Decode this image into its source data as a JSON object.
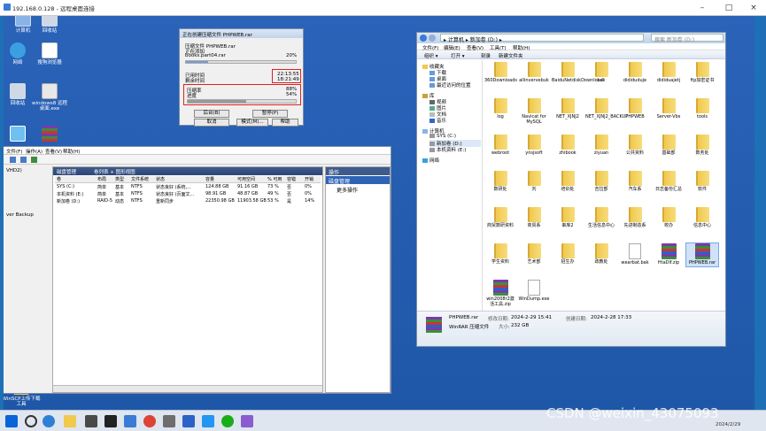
{
  "rdp": {
    "title": "192.168.0.128 - 远程桌面连接"
  },
  "desktop_icons": [
    {
      "label": "计算机",
      "icon": "computer-icon"
    },
    {
      "label": "回收站",
      "icon": "recycle-bin-icon"
    },
    {
      "label": "网络",
      "icon": "network-icon"
    },
    {
      "label": "搜狗浏览器",
      "icon": "browser-icon"
    },
    {
      "label": "回收站",
      "icon": "recycle-bin-icon"
    },
    {
      "label": "windows8 远程桌面.exe",
      "icon": "app-icon"
    },
    {
      "label": "",
      "icon": "monitor-icon"
    },
    {
      "label": "",
      "icon": "rar-icon"
    },
    {
      "label": "WinSCP上传下载工具",
      "icon": "folder-icon"
    }
  ],
  "rar_dialog": {
    "title": "正在创建压缩文件 PHPWEB.rar",
    "line1": "压缩文件 PHPWEB.rar",
    "line2": "正在添加",
    "file": "books.part04.rar",
    "file_pct": "20%",
    "elapsed_label": "已用时间",
    "elapsed": "22:13:55",
    "remaining_label": "剩余时间",
    "remaining": "18:21:49",
    "progress_label": "压缩率",
    "progress_label2": "进度",
    "ratio": "88%",
    "progress_pct": "54%",
    "progress": 0.54,
    "buttons": [
      "后台(B)",
      "暂停(P)",
      "取消",
      "模式(M)...",
      "帮助"
    ]
  },
  "disk_mgmt": {
    "menu": [
      "文件(F)",
      "操作(A)",
      "查看(V)",
      "帮助(H)"
    ],
    "panel_title": "磁盘管理",
    "panel_sub": "卷列表 + 图形视图",
    "left_text": [
      "VHD2)",
      "ver Backup"
    ],
    "headers": [
      "卷",
      "布局",
      "类型",
      "文件系统",
      "状态",
      "容量",
      "可用空间",
      "% 可用",
      "容错",
      "开销"
    ],
    "rows": [
      [
        "SYS (C:)",
        "简单",
        "基本",
        "NTFS",
        "状态良好 (系统,...",
        "124.88 GB",
        "91.16 GB",
        "73 %",
        "否",
        "0%"
      ],
      [
        "本机资料 (E:)",
        "简单",
        "基本",
        "NTFS",
        "状态良好 (页面文...",
        "98.91 GB",
        "48.87 GB",
        "49 %",
        "否",
        "0%"
      ],
      [
        "新加卷 (D:)",
        "RAID-5",
        "动态",
        "NTFS",
        "重新同步",
        "22350.98 GB",
        "11903.58 GB",
        "53 %",
        "是",
        "14%"
      ]
    ],
    "ops_title": "操作",
    "ops_sel": "磁盘管理",
    "ops_more": "更多操作"
  },
  "explorer": {
    "breadcrumb": "▸ 计算机 ▸ 新加卷 (D:) ▸",
    "search_placeholder": "搜索 新加卷 (D:)",
    "menu": [
      "文件(F)",
      "编辑(E)",
      "查看(V)",
      "工具(T)",
      "帮助(H)"
    ],
    "toolbar": [
      "组织 ▾",
      "打开 ▾",
      "刻录",
      "新建文件夹"
    ],
    "nav": [
      "收藏夹",
      "下载",
      "桌面",
      "最近访问的位置",
      "库",
      "视频",
      "图片",
      "文档",
      "音乐",
      "计算机",
      "SYS (C:)",
      "新加卷 (D:)",
      "本机资料 (E:)",
      "网络"
    ],
    "items": [
      [
        "360Downloads",
        "folder"
      ],
      [
        "allinvervebuk",
        "folder"
      ],
      [
        "BaiduNetdiskDownload",
        "folder"
      ],
      [
        "bak",
        "folder"
      ],
      [
        "dididuduje",
        "folder"
      ],
      [
        "dididuajetj",
        "folder"
      ],
      [
        "ftp加密证书",
        "folder"
      ],
      [
        "log",
        "folder"
      ],
      [
        "Navicat for MySQL",
        "folder"
      ],
      [
        "NET_XJNJ2",
        "folder"
      ],
      [
        "NET_XJNJ2_BACKUP",
        "folder"
      ],
      [
        "PHPWEB",
        "folder"
      ],
      [
        "Server-Vbs",
        "folder"
      ],
      [
        "tools",
        "folder"
      ],
      [
        "webroot",
        "folder"
      ],
      [
        "ynsjsoft",
        "folder"
      ],
      [
        "zhibook",
        "folder"
      ],
      [
        "ziyuan",
        "folder"
      ],
      [
        "公共资料",
        "folder"
      ],
      [
        "基础部",
        "folder"
      ],
      [
        "数务处",
        "folder"
      ],
      [
        "数研处",
        "folder"
      ],
      [
        "刘",
        "folder"
      ],
      [
        "培训处",
        "folder"
      ],
      [
        "吉拉部",
        "folder"
      ],
      [
        "汽车系",
        "folder"
      ],
      [
        "日志备份汇总",
        "folder"
      ],
      [
        "软件",
        "folder"
      ],
      [
        "商贸数研资料",
        "folder"
      ],
      [
        "商贸系",
        "folder"
      ],
      [
        "串库2",
        "folder"
      ],
      [
        "生活信息中心",
        "folder"
      ],
      [
        "先进制造系",
        "folder"
      ],
      [
        "校办",
        "folder"
      ],
      [
        "信息中心",
        "folder"
      ],
      [
        "学生资料",
        "folder"
      ],
      [
        "艺术部",
        "folder"
      ],
      [
        "招生办",
        "folder"
      ],
      [
        "政教处",
        "folder"
      ],
      [
        "wearbat.bak",
        "doc"
      ],
      [
        "HtaDlf.zip",
        "rar"
      ],
      [
        "PHPWEB.rar",
        "rar"
      ],
      [
        "win2008r2激活工具.zip",
        "rar"
      ],
      [
        "WinDump.exe",
        "doc"
      ]
    ],
    "status": {
      "name": "PHPWEB.rar",
      "type": "WinRAR 压缩文件",
      "mod_label": "修改日期:",
      "mod": "2024-2-29 15:41",
      "size_label": "大小:",
      "size": "232 GB",
      "create_label": "创建日期:",
      "create": "2024-2-28 17:33"
    }
  },
  "taskbar": {
    "time": "",
    "date": "2024/2/29"
  },
  "watermark": "CSDN @weixin_43075093"
}
